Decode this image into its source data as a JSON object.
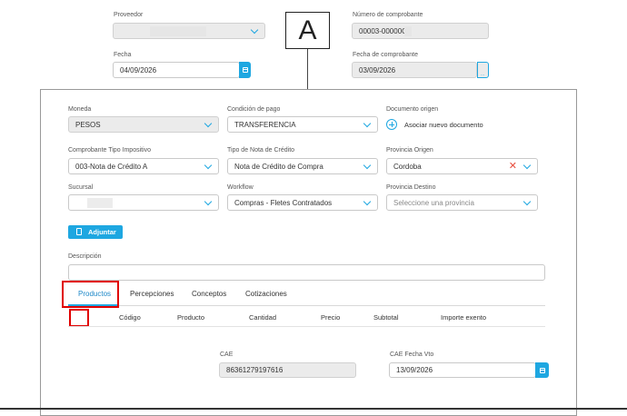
{
  "top": {
    "proveedor": {
      "label": "Proveedor",
      "value": ""
    },
    "numero": {
      "label": "Número de comprobante",
      "value": "00003-00000C"
    },
    "fecha": {
      "label": "Fecha",
      "value": "04/09/2026"
    },
    "fecha_comprobante": {
      "label": "Fecha de comprobante",
      "value": "03/09/2026"
    }
  },
  "annotation": {
    "letter": "A"
  },
  "form": {
    "moneda": {
      "label": "Moneda",
      "value": "PESOS"
    },
    "condicion": {
      "label": "Condición de pago",
      "value": "TRANSFERENCIA"
    },
    "documento": {
      "label": "Documento origen",
      "link": "Asociar nuevo documento"
    },
    "tipo_impositivo": {
      "label": "Comprobante Tipo Impositivo",
      "value": "003-Nota de Crédito A"
    },
    "tipo_nota": {
      "label": "Tipo de Nota de Crédito",
      "value": "Nota de Crédito de Compra"
    },
    "provincia_origen": {
      "label": "Provincia Origen",
      "value": "Cordoba"
    },
    "sucursal": {
      "label": "Sucursal",
      "value": ""
    },
    "workflow": {
      "label": "Workflow",
      "value": "Compras - Fletes Contratados"
    },
    "provincia_destino": {
      "label": "Provincia Destino",
      "placeholder": "Seleccione una provincia"
    },
    "adjuntar": "Adjuntar",
    "descripcion": {
      "label": "Descripción",
      "value": ""
    }
  },
  "tabs": [
    "Productos",
    "Percepciones",
    "Conceptos",
    "Cotizaciones"
  ],
  "table_headers": [
    "Código",
    "Producto",
    "Cantidad",
    "Precio",
    "Subtotal",
    "Importe exento"
  ],
  "cae": {
    "label": "CAE",
    "value": "86361279197616"
  },
  "cae_fecha": {
    "label": "CAE Fecha Vto",
    "value": "13/09/2026"
  },
  "colors": {
    "accent": "#1ea7e1",
    "highlight": "#e00000"
  }
}
